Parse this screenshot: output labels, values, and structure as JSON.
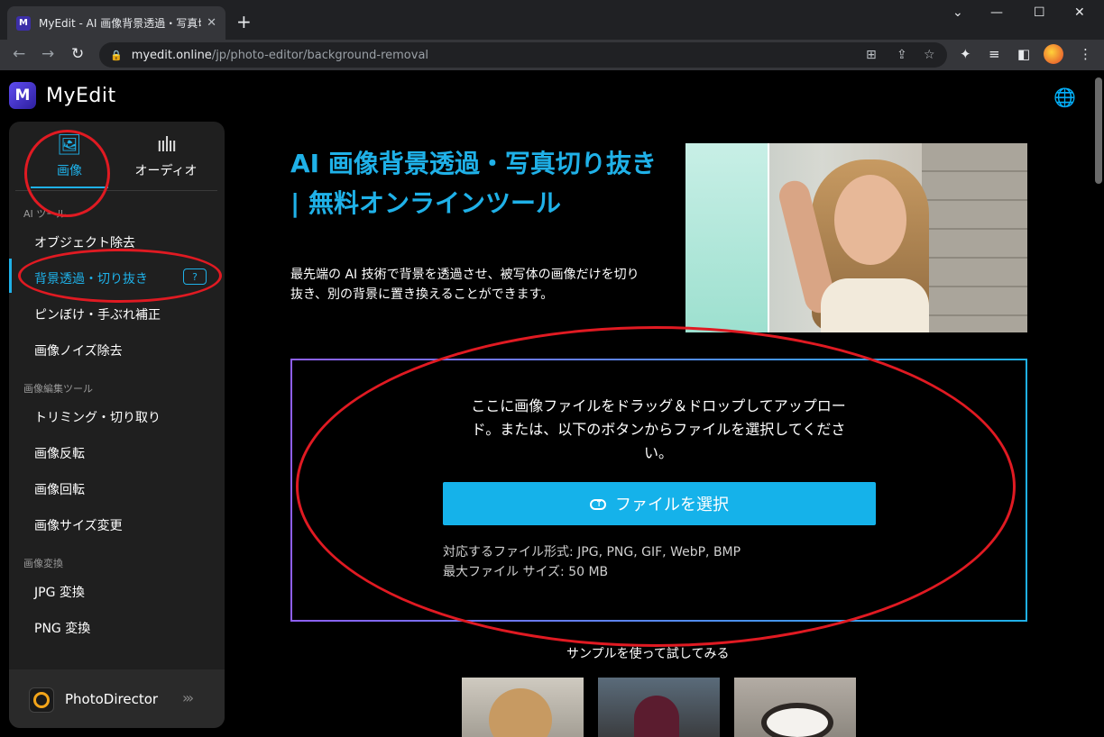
{
  "browser": {
    "tab_title": "MyEdit - AI 画像背景透過・写真切",
    "tab_favicon": "M",
    "url_host": "myedit.online",
    "url_path": "/jp/photo-editor/background-removal"
  },
  "site": {
    "logo_letter": "M",
    "logo_text": "MyEdit"
  },
  "sidebar": {
    "category_tabs": [
      {
        "label": "画像",
        "icon": "image-icon",
        "active": true
      },
      {
        "label": "オーディオ",
        "icon": "audio-wave-icon",
        "active": false
      }
    ],
    "sections": [
      {
        "heading": "AI ツール",
        "items": [
          "オブジェクト除去",
          "背景透過・切り抜き",
          "ピンぼけ・手ぶれ補正",
          "画像ノイズ除去"
        ]
      },
      {
        "heading": "画像編集ツール",
        "items": [
          "トリミング・切り取り",
          "画像反転",
          "画像回転",
          "画像サイズ変更"
        ]
      },
      {
        "heading": "画像変換",
        "items": [
          "JPG 変換",
          "PNG 変換"
        ]
      }
    ],
    "active_item": "背景透過・切り抜き",
    "help_icon_text": "?",
    "footer_label": "PhotoDirector",
    "footer_arrow": "›››"
  },
  "main": {
    "title": "AI 画像背景透過・写真切り抜き | 無料オンラインツール",
    "description": "最先端の AI 技術で背景を透過させ、被写体の画像だけを切り抜き、別の背景に置き換えることができます。",
    "drop_text": "ここに画像ファイルをドラッグ＆ドロップしてアップロード。または、以下のボタンからファイルを選択してください。",
    "upload_button": "ファイルを選択",
    "formats_line": "対応するファイル形式: JPG, PNG, GIF, WebP, BMP",
    "max_size_line": "最大ファイル サイズ: 50 MB",
    "sample_title": "サンプルを使って試してみる"
  },
  "colors": {
    "accent": "#1fb1e8",
    "annotation": "#e01a22",
    "sidebar_bg": "#1f1f1f"
  }
}
